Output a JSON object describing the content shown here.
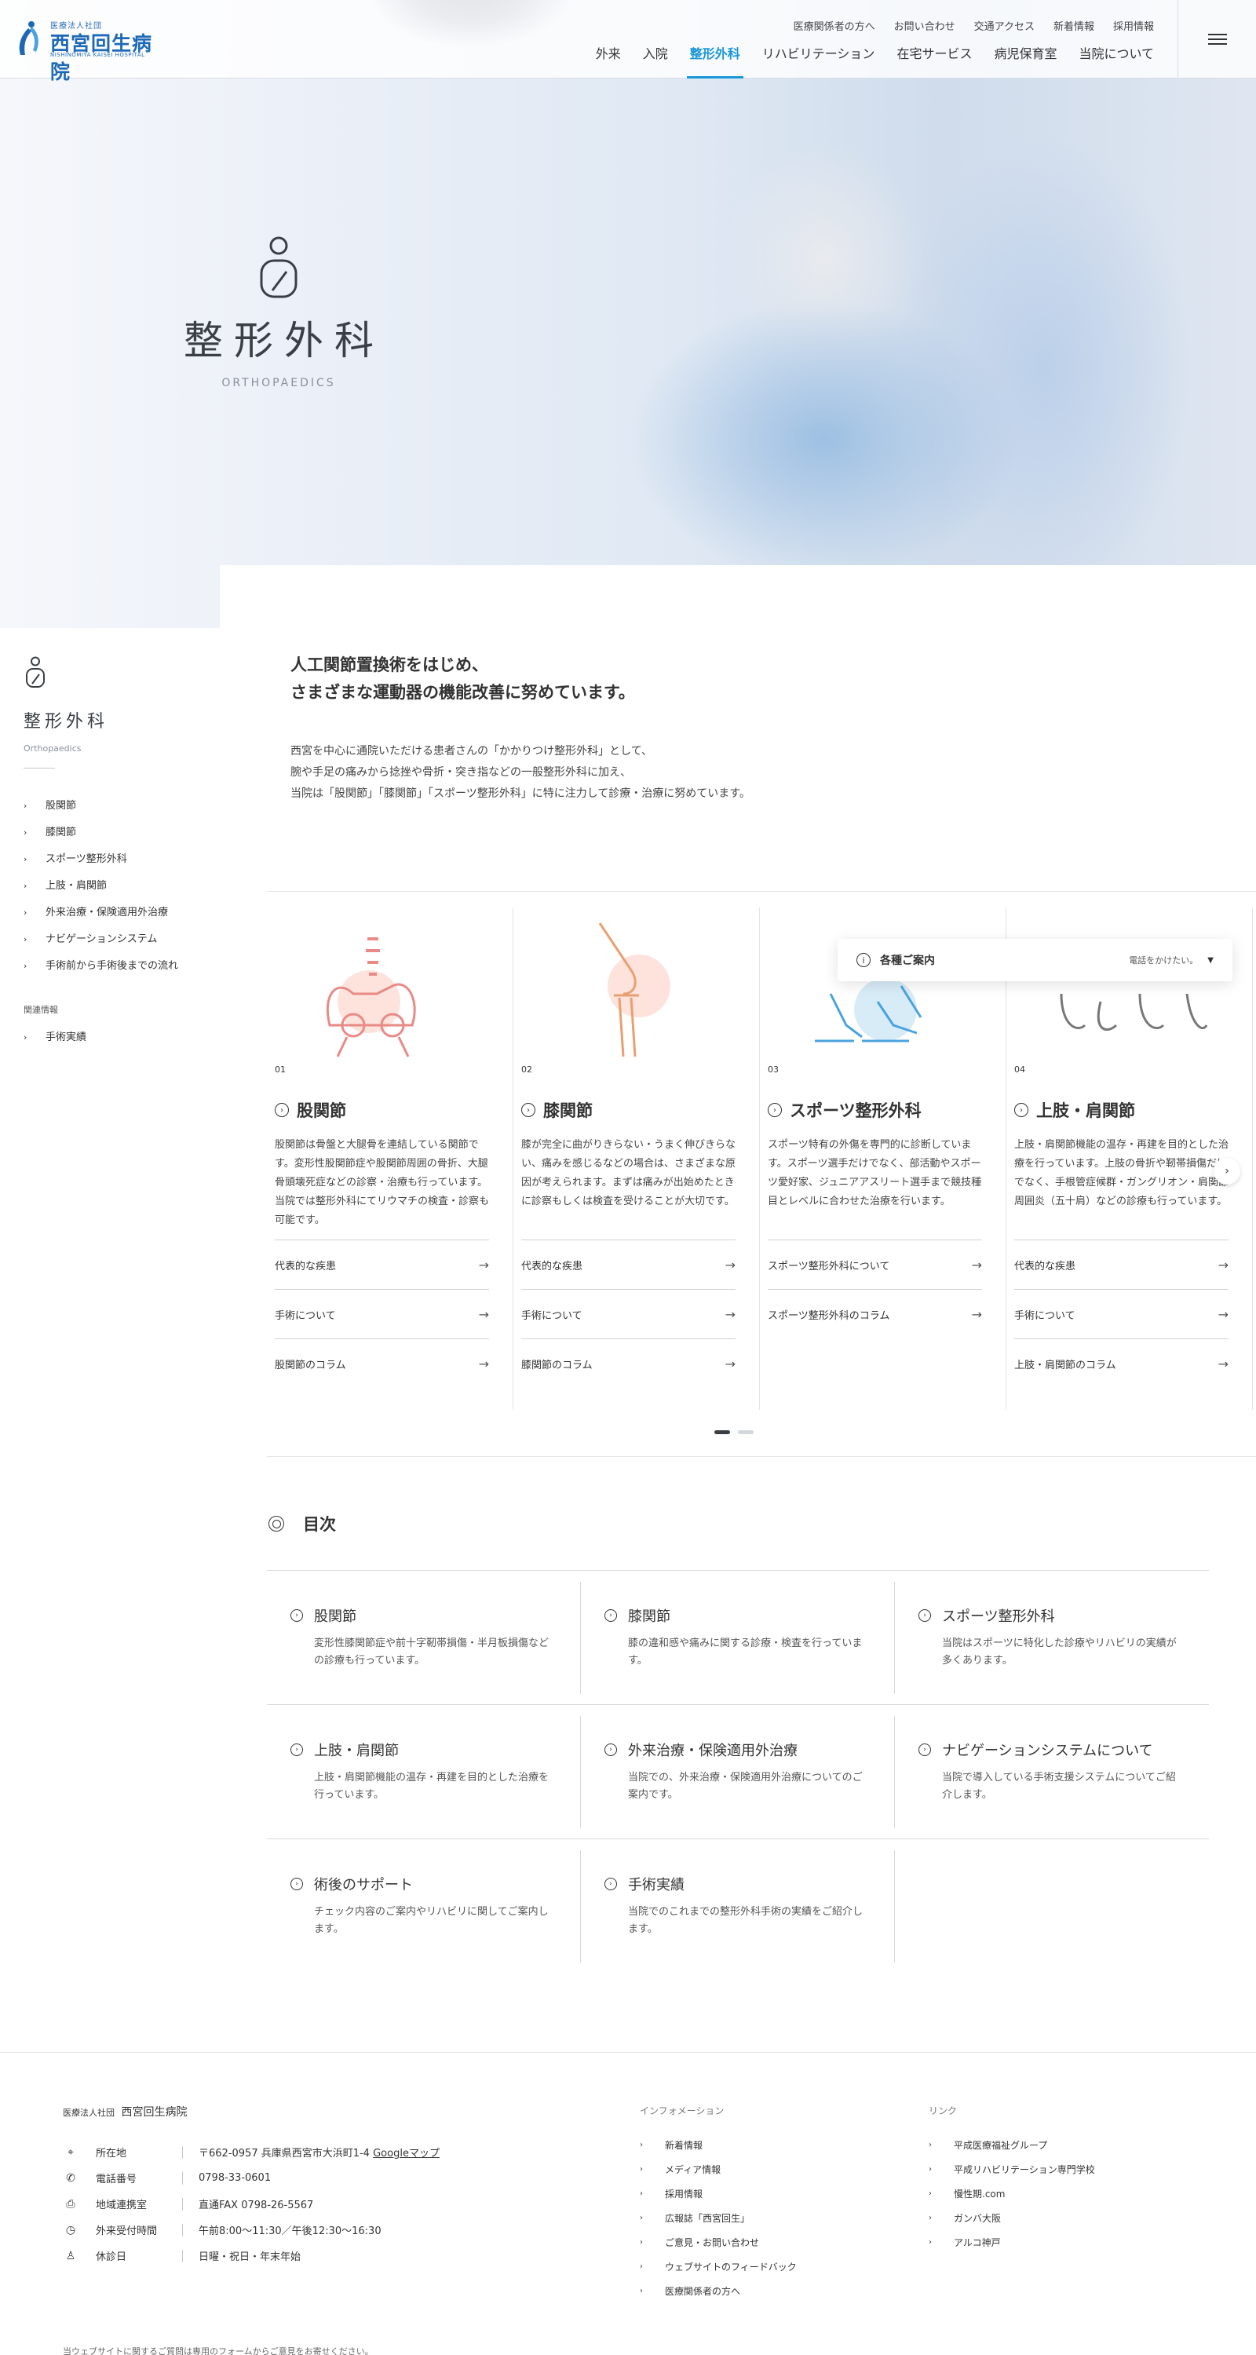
{
  "header": {
    "logo_sub": "医療法人社団",
    "logo_name": "西宮回生病院",
    "logo_eng": "NISHINOMIYA KAISEI HOSPITAL",
    "util_nav": [
      "医療関係者の方へ",
      "お問い合わせ",
      "交通アクセス",
      "新着情報",
      "採用情報"
    ],
    "main_nav": [
      "外来",
      "入院",
      "整形外科",
      "リハビリテーション",
      "在宅サービス",
      "病児保育室",
      "当院について"
    ],
    "active_nav": "整形外科"
  },
  "hero": {
    "title": "整形外科",
    "subtitle": "ORTHOPAEDICS"
  },
  "sidebar": {
    "title": "整形外科",
    "subtitle": "Orthopaedics",
    "items": [
      "股関節",
      "膝関節",
      "スポーツ整形外科",
      "上肢・肩関節",
      "外来治療・保険適用外治療",
      "ナビゲーションシステム",
      "手術前から手術後までの流れ"
    ],
    "related_heading": "関連情報",
    "related_items": [
      "手術実績"
    ]
  },
  "intro": {
    "lead_line1": "人工関節置換術をはじめ、",
    "lead_line2": "さまざまな運動器の機能改善に努めています。",
    "body_line1": "西宮を中心に通院いただける患者さんの「かかりつけ整形外科」として、",
    "body_line2": "腕や手足の痛みから捻挫や骨折・突き指などの一般整形外科に加え、",
    "body_line3": "当院は「股関節」「膝関節」「スポーツ整形外科」に特に注力して診療・治療に努めています。"
  },
  "cards": [
    {
      "num": "01",
      "title": "股関節",
      "desc": "股関節は骨盤と大腿骨を連結している関節です。変形性股関節症や股関節周囲の骨折、大腿骨頭壊死症などの診察・治療も行っています。当院では整形外科にてリウマチの検査・診察も可能です。",
      "links": [
        "代表的な疾患",
        "手術について",
        "股関節のコラム"
      ]
    },
    {
      "num": "02",
      "title": "膝関節",
      "desc": "膝が完全に曲がりきらない・うまく伸びきらない、痛みを感じるなどの場合は、さまざまな原因が考えられます。まずは痛みが出始めたときに診察もしくは検査を受けることが大切です。",
      "links": [
        "代表的な疾患",
        "手術について",
        "膝関節のコラム"
      ]
    },
    {
      "num": "03",
      "title": "スポーツ整形外科",
      "desc": "スポーツ特有の外傷を専門的に診断しています。スポーツ選手だけでなく、部活動やスポーツ愛好家、ジュニアアスリート選手まで競技種目とレベルに合わせた治療を行います。",
      "links": [
        "スポーツ整形外科について",
        "スポーツ整形外科のコラム"
      ]
    },
    {
      "num": "04",
      "title": "上肢・肩関節",
      "desc": "上肢・肩関節機能の温存・再建を目的とした治療を行っています。上肢の骨折や靭帯損傷だけでなく、手根管症候群・ガングリオン・肩関節周囲炎（五十肩）などの診療も行っています。",
      "links": [
        "代表的な疾患",
        "手術について",
        "上肢・肩関節のコラム"
      ]
    }
  ],
  "popup": {
    "label": "各種ご案内",
    "small": "電話をかけたい。"
  },
  "toc": {
    "title": "目次",
    "items": [
      {
        "name": "股関節",
        "desc": "変形性膝関節症や前十字靭帯損傷・半月板損傷などの診療も行っています。"
      },
      {
        "name": "膝関節",
        "desc": "膝の違和感や痛みに関する診療・検査を行っています。"
      },
      {
        "name": "スポーツ整形外科",
        "desc": "当院はスポーツに特化した診療やリハビリの実績が多くあります。"
      },
      {
        "name": "上肢・肩関節",
        "desc": "上肢・肩関節機能の温存・再建を目的とした治療を行っています。"
      },
      {
        "name": "外来治療・保険適用外治療",
        "desc": "当院での、外来治療・保険適用外治療についてのご案内です。"
      },
      {
        "name": "ナビゲーションシステムについて",
        "desc": "当院で導入している手術支援システムについてご紹介します。"
      },
      {
        "name": "術後のサポート",
        "desc": "チェック内容のご案内やリハビリに関してご案内します。"
      },
      {
        "name": "手術実績",
        "desc": "当院でのこれまでの整形外科手術の実績をご紹介します。"
      }
    ]
  },
  "footer": {
    "org_prefix": "医療法人社団",
    "org_name": "西宮回生病院",
    "address_label": "所在地",
    "address": "〒662-0957 兵庫県西宮市大浜町1-4",
    "map_link": "Googleマップ",
    "phone_label": "電話番号",
    "phone": "0798-33-0601",
    "fax_label": "地域連携室",
    "fax": "直通FAX 0798-26-5567",
    "hours_label": "外来受付時間",
    "hours": "午前8:00〜11:30／午後12:30〜16:30",
    "holiday_label": "休診日",
    "holiday": "日曜・祝日・年末年始",
    "info_heading": "インフォメーション",
    "info_links": [
      "新着情報",
      "メディア情報",
      "採用情報",
      "広報誌「西宮回生」",
      "ご意見・お問い合わせ",
      "ウェブサイトのフィードバック",
      "医療関係者の方へ"
    ],
    "link_heading": "リンク",
    "links": [
      "平成医療福祉グループ",
      "平成リハビリテーション専門学校",
      "慢性期.com",
      "ガンバ大阪",
      "アルコ神戸"
    ],
    "bottom_text": "当ウェブサイトに関するご質問は専用のフォームからご意見をお寄せください。"
  }
}
